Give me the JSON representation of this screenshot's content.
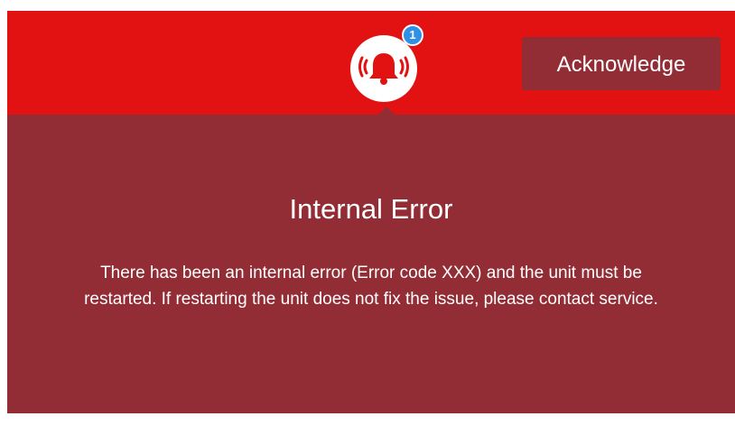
{
  "alarm": {
    "icon": "alarm-bell-icon",
    "badge_count": "1",
    "badge_color": "#2f90e6"
  },
  "header": {
    "acknowledge_label": "Acknowledge"
  },
  "error": {
    "title": "Internal Error",
    "message": "There has been an internal error (Error code XXX) and the unit must be restarted. If restarting the unit does not fix the issue, please contact service."
  },
  "colors": {
    "top_bar": "#e31212",
    "panel": "#922d36",
    "text": "#ffffff"
  }
}
